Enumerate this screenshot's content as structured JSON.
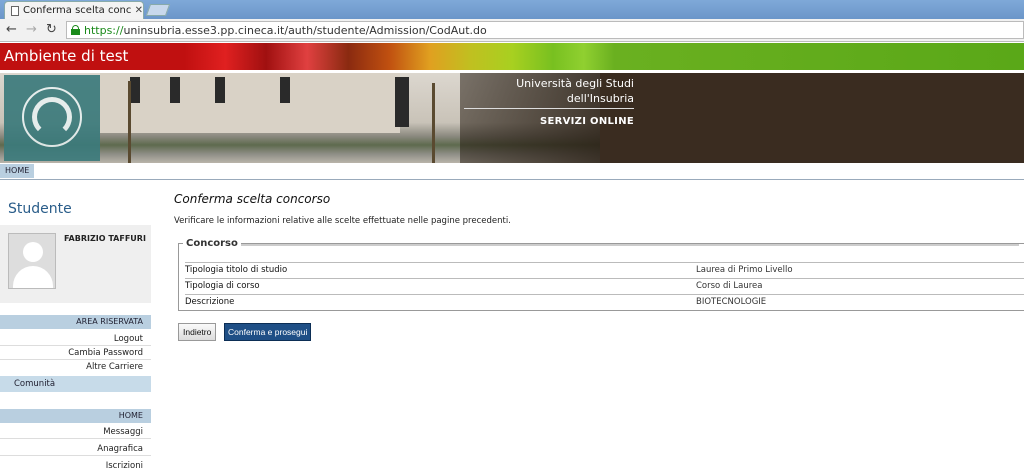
{
  "browser": {
    "tab_title": "Conferma scelta conc",
    "url_https": "https://",
    "url_rest": "uninsubria.esse3.pp.cineca.it/auth/studente/Admission/CodAut.do"
  },
  "banner": {
    "test_label": "Ambiente di test"
  },
  "header": {
    "university_line1": "Università degli Studi",
    "university_line2": "dell'Insubria",
    "services": "SERVIZI ONLINE"
  },
  "nav": {
    "home": "HOME"
  },
  "sidebar": {
    "title": "Studente",
    "user_name": "FABRIZIO TAFFURI",
    "reserved_area": "AREA RISERVATA",
    "reserved_links": [
      "Logout",
      "Cambia Password",
      "Altre Carriere"
    ],
    "comunita": "Comunità",
    "home_section": "HOME",
    "home_links": [
      "Messaggi",
      "Anagrafica",
      "Iscrizioni"
    ]
  },
  "main": {
    "title": "Conferma scelta concorso",
    "description": "Verificare le informazioni relative alle scelte effettuate nelle pagine precedenti.",
    "fieldset_legend": "Concorso",
    "rows": [
      {
        "label": "Tipologia titolo di studio",
        "value": "Laurea di Primo Livello"
      },
      {
        "label": "Tipologia di corso",
        "value": "Corso di Laurea"
      },
      {
        "label": "Descrizione",
        "value": "BIOTECNOLOGIE"
      }
    ],
    "back_button": "Indietro",
    "confirm_button": "Conferma e prosegui"
  }
}
